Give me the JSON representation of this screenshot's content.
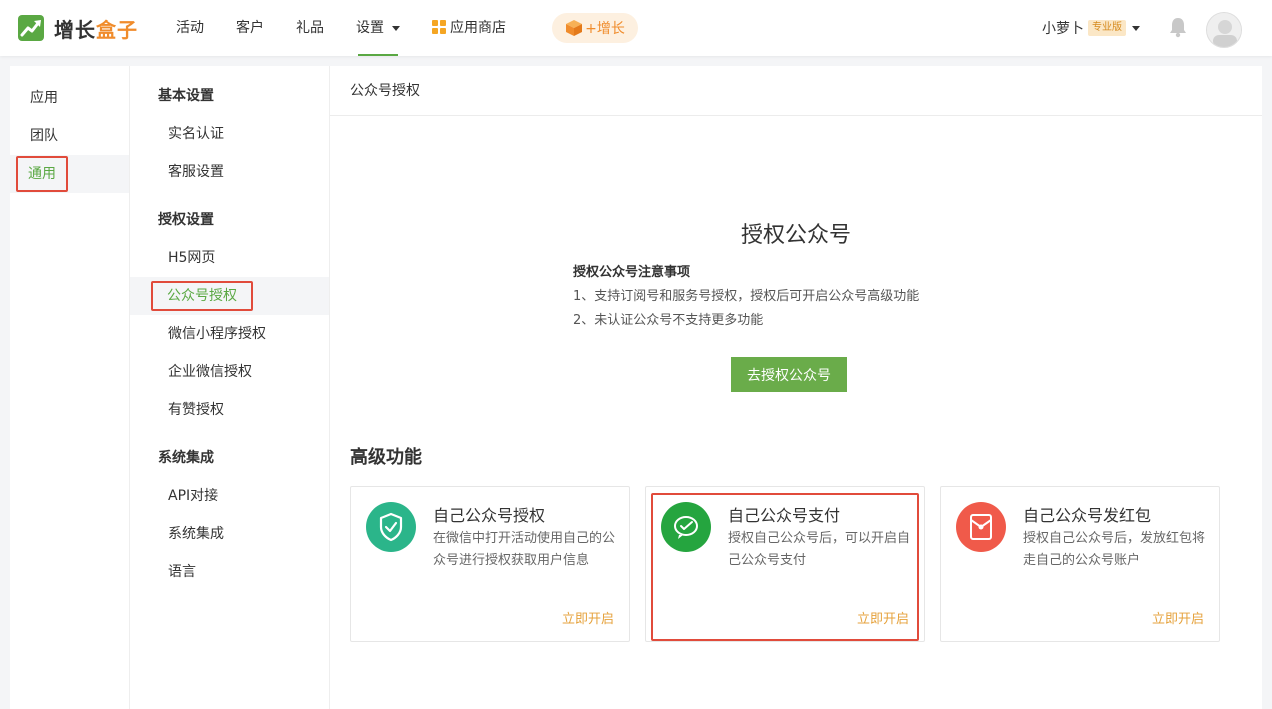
{
  "header": {
    "logo": {
      "part1": "增长",
      "part2": "盒子"
    },
    "nav": [
      {
        "label": "活动"
      },
      {
        "label": "客户"
      },
      {
        "label": "礼品"
      },
      {
        "label": "设置"
      },
      {
        "label": "应用商店"
      }
    ],
    "growth_label": "+增长",
    "user": {
      "name": "小萝卜",
      "badge": "专业版"
    }
  },
  "sidebar": {
    "items": [
      {
        "label": "应用"
      },
      {
        "label": "团队"
      },
      {
        "label": "通用"
      }
    ]
  },
  "subnav": {
    "groups": [
      {
        "title": "基本设置",
        "items": [
          {
            "label": "实名认证"
          },
          {
            "label": "客服设置"
          }
        ]
      },
      {
        "title": "授权设置",
        "items": [
          {
            "label": "H5网页"
          },
          {
            "label": "公众号授权"
          },
          {
            "label": "微信小程序授权"
          },
          {
            "label": "企业微信授权"
          },
          {
            "label": "有赞授权"
          }
        ]
      },
      {
        "title": "系统集成",
        "items": [
          {
            "label": "API对接"
          },
          {
            "label": "系统集成"
          },
          {
            "label": "语言"
          }
        ]
      }
    ]
  },
  "main": {
    "breadcrumb": "公众号授权",
    "auth_title": "授权公众号",
    "notes": {
      "title": "授权公众号注意事项",
      "lines": [
        "1、支持订阅号和服务号授权，授权后可开启公众号高级功能",
        "2、未认证公众号不支持更多功能"
      ]
    },
    "auth_button": "去授权公众号",
    "section_title": "高级功能",
    "cards": [
      {
        "title": "自己公众号授权",
        "desc": "在微信中打开活动使用自己的公众号进行授权获取用户信息",
        "link": "立即开启",
        "icon": "shield-check-icon",
        "color": "#2bb58a"
      },
      {
        "title": "自己公众号支付",
        "desc": "授权自己公众号后，可以开启自己公众号支付",
        "link": "立即开启",
        "icon": "wechat-pay-icon",
        "color": "#25a53f"
      },
      {
        "title": "自己公众号发红包",
        "desc": "授权自己公众号后，发放红包将走自己的公众号账户",
        "link": "立即开启",
        "icon": "red-packet-icon",
        "color": "#f05a4a"
      }
    ]
  },
  "colors": {
    "brand": "#5aa843",
    "accent": "#f08c2c",
    "highlight": "#e14b3b",
    "link": "#e6a23c"
  }
}
